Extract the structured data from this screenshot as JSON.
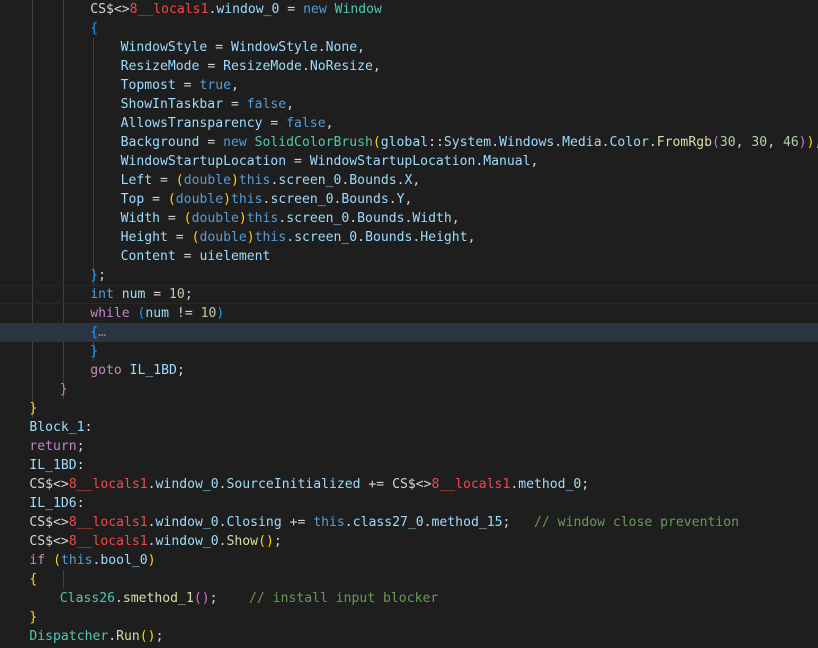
{
  "colors": {
    "background": "#1e1e1e",
    "keyword": "#569cd6",
    "control": "#c586c0",
    "type": "#4ec9b0",
    "property": "#9cdcfe",
    "number": "#b5cea8",
    "function": "#dcdcaa",
    "comment": "#6a9955",
    "bracket_gold": "#ffd700",
    "bracket_orchid": "#da70d6",
    "bracket_blue": "#179fff"
  },
  "code": {
    "lines": [
      {
        "indent": 12,
        "tokens": [
          [
            "txt",
            "CS$<>"
          ],
          [
            "red",
            "8"
          ],
          [
            "red",
            "__locals1"
          ],
          [
            "txt",
            "."
          ],
          [
            "prop",
            "window_0"
          ],
          [
            "txt",
            " = "
          ],
          [
            "kw",
            "new"
          ],
          [
            "txt",
            " "
          ],
          [
            "type",
            "Window"
          ]
        ]
      },
      {
        "indent": 12,
        "tokens": [
          [
            "p3",
            "{"
          ]
        ]
      },
      {
        "indent": 16,
        "tokens": [
          [
            "prop",
            "WindowStyle"
          ],
          [
            "txt",
            " = "
          ],
          [
            "prop",
            "WindowStyle"
          ],
          [
            "txt",
            "."
          ],
          [
            "prop",
            "None"
          ],
          [
            "txt",
            ","
          ]
        ]
      },
      {
        "indent": 16,
        "tokens": [
          [
            "prop",
            "ResizeMode"
          ],
          [
            "txt",
            " = "
          ],
          [
            "prop",
            "ResizeMode"
          ],
          [
            "txt",
            "."
          ],
          [
            "prop",
            "NoResize"
          ],
          [
            "txt",
            ","
          ]
        ]
      },
      {
        "indent": 16,
        "tokens": [
          [
            "prop",
            "Topmost"
          ],
          [
            "txt",
            " = "
          ],
          [
            "kw",
            "true"
          ],
          [
            "txt",
            ","
          ]
        ]
      },
      {
        "indent": 16,
        "tokens": [
          [
            "prop",
            "ShowInTaskbar"
          ],
          [
            "txt",
            " = "
          ],
          [
            "kw",
            "false"
          ],
          [
            "txt",
            ","
          ]
        ]
      },
      {
        "indent": 16,
        "tokens": [
          [
            "prop",
            "AllowsTransparency"
          ],
          [
            "txt",
            " = "
          ],
          [
            "kw",
            "false"
          ],
          [
            "txt",
            ","
          ]
        ]
      },
      {
        "indent": 16,
        "tokens": [
          [
            "prop",
            "Background"
          ],
          [
            "txt",
            " = "
          ],
          [
            "kw",
            "new"
          ],
          [
            "txt",
            " "
          ],
          [
            "type",
            "SolidColorBrush"
          ],
          [
            "p1",
            "("
          ],
          [
            "prop",
            "global"
          ],
          [
            "txt",
            "::"
          ],
          [
            "prop",
            "System"
          ],
          [
            "txt",
            "."
          ],
          [
            "prop",
            "Windows"
          ],
          [
            "txt",
            "."
          ],
          [
            "prop",
            "Media"
          ],
          [
            "txt",
            "."
          ],
          [
            "prop",
            "Color"
          ],
          [
            "txt",
            "."
          ],
          [
            "fn",
            "FromRgb"
          ],
          [
            "p2",
            "("
          ],
          [
            "num",
            "30"
          ],
          [
            "txt",
            ", "
          ],
          [
            "num",
            "30"
          ],
          [
            "txt",
            ", "
          ],
          [
            "num",
            "46"
          ],
          [
            "p2",
            ")"
          ],
          [
            "p1",
            ")"
          ],
          [
            "txt",
            ","
          ]
        ]
      },
      {
        "indent": 16,
        "tokens": [
          [
            "prop",
            "WindowStartupLocation"
          ],
          [
            "txt",
            " = "
          ],
          [
            "prop",
            "WindowStartupLocation"
          ],
          [
            "txt",
            "."
          ],
          [
            "prop",
            "Manual"
          ],
          [
            "txt",
            ","
          ]
        ]
      },
      {
        "indent": 16,
        "tokens": [
          [
            "prop",
            "Left"
          ],
          [
            "txt",
            " = "
          ],
          [
            "p1",
            "("
          ],
          [
            "kw",
            "double"
          ],
          [
            "p1",
            ")"
          ],
          [
            "kw",
            "this"
          ],
          [
            "txt",
            "."
          ],
          [
            "prop",
            "screen_0"
          ],
          [
            "txt",
            "."
          ],
          [
            "prop",
            "Bounds"
          ],
          [
            "txt",
            "."
          ],
          [
            "prop",
            "X"
          ],
          [
            "txt",
            ","
          ]
        ]
      },
      {
        "indent": 16,
        "tokens": [
          [
            "prop",
            "Top"
          ],
          [
            "txt",
            " = "
          ],
          [
            "p1",
            "("
          ],
          [
            "kw",
            "double"
          ],
          [
            "p1",
            ")"
          ],
          [
            "kw",
            "this"
          ],
          [
            "txt",
            "."
          ],
          [
            "prop",
            "screen_0"
          ],
          [
            "txt",
            "."
          ],
          [
            "prop",
            "Bounds"
          ],
          [
            "txt",
            "."
          ],
          [
            "prop",
            "Y"
          ],
          [
            "txt",
            ","
          ]
        ]
      },
      {
        "indent": 16,
        "tokens": [
          [
            "prop",
            "Width"
          ],
          [
            "txt",
            " = "
          ],
          [
            "p1",
            "("
          ],
          [
            "kw",
            "double"
          ],
          [
            "p1",
            ")"
          ],
          [
            "kw",
            "this"
          ],
          [
            "txt",
            "."
          ],
          [
            "prop",
            "screen_0"
          ],
          [
            "txt",
            "."
          ],
          [
            "prop",
            "Bounds"
          ],
          [
            "txt",
            "."
          ],
          [
            "prop",
            "Width"
          ],
          [
            "txt",
            ","
          ]
        ]
      },
      {
        "indent": 16,
        "tokens": [
          [
            "prop",
            "Height"
          ],
          [
            "txt",
            " = "
          ],
          [
            "p1",
            "("
          ],
          [
            "kw",
            "double"
          ],
          [
            "p1",
            ")"
          ],
          [
            "kw",
            "this"
          ],
          [
            "txt",
            "."
          ],
          [
            "prop",
            "screen_0"
          ],
          [
            "txt",
            "."
          ],
          [
            "prop",
            "Bounds"
          ],
          [
            "txt",
            "."
          ],
          [
            "prop",
            "Height"
          ],
          [
            "txt",
            ","
          ]
        ]
      },
      {
        "indent": 16,
        "tokens": [
          [
            "prop",
            "Content"
          ],
          [
            "txt",
            " = "
          ],
          [
            "prop",
            "uielement"
          ]
        ]
      },
      {
        "indent": 12,
        "tokens": [
          [
            "p3",
            "}"
          ],
          [
            "txt",
            ";"
          ]
        ]
      },
      {
        "indent": 12,
        "current": true,
        "tokens": [
          [
            "kw",
            "int"
          ],
          [
            "txt",
            " "
          ],
          [
            "prop",
            "num"
          ],
          [
            "txt",
            " = "
          ],
          [
            "num",
            "10"
          ],
          [
            "txt",
            ";"
          ]
        ]
      },
      {
        "indent": 12,
        "tokens": [
          [
            "ctl",
            "while"
          ],
          [
            "txt",
            " "
          ],
          [
            "p3",
            "("
          ],
          [
            "prop",
            "num"
          ],
          [
            "txt",
            " != "
          ],
          [
            "num",
            "10"
          ],
          [
            "p3",
            ")"
          ]
        ]
      },
      {
        "indent": 12,
        "highlight": true,
        "tokens": [
          [
            "p3",
            "{"
          ],
          [
            "fold",
            "…"
          ]
        ]
      },
      {
        "indent": 12,
        "tokens": [
          [
            "p3",
            "}"
          ]
        ]
      },
      {
        "indent": 12,
        "tokens": [
          [
            "ctl",
            "goto"
          ],
          [
            "txt",
            " "
          ],
          [
            "prop",
            "IL_1BD"
          ],
          [
            "txt",
            ";"
          ]
        ]
      },
      {
        "indent": 8,
        "tokens": [
          [
            "p2",
            "}"
          ]
        ]
      },
      {
        "indent": 4,
        "tokens": [
          [
            "p1",
            "}"
          ]
        ]
      },
      {
        "indent": 4,
        "tokens": [
          [
            "prop",
            "Block_1"
          ],
          [
            "txt",
            ":"
          ]
        ]
      },
      {
        "indent": 4,
        "tokens": [
          [
            "ctl",
            "return"
          ],
          [
            "txt",
            ";"
          ]
        ]
      },
      {
        "indent": 4,
        "tokens": [
          [
            "prop",
            "IL_1BD"
          ],
          [
            "txt",
            ":"
          ]
        ]
      },
      {
        "indent": 4,
        "tokens": [
          [
            "txt",
            "CS$<>"
          ],
          [
            "red",
            "8"
          ],
          [
            "red",
            "__locals1"
          ],
          [
            "txt",
            "."
          ],
          [
            "prop",
            "window_0"
          ],
          [
            "txt",
            "."
          ],
          [
            "prop",
            "SourceInitialized"
          ],
          [
            "txt",
            " += CS$<>"
          ],
          [
            "red",
            "8"
          ],
          [
            "red",
            "__locals1"
          ],
          [
            "txt",
            "."
          ],
          [
            "prop",
            "method_0"
          ],
          [
            "txt",
            ";"
          ]
        ]
      },
      {
        "indent": 4,
        "tokens": [
          [
            "prop",
            "IL_1D6"
          ],
          [
            "txt",
            ":"
          ]
        ]
      },
      {
        "indent": 4,
        "tokens": [
          [
            "txt",
            "CS$<>"
          ],
          [
            "red",
            "8"
          ],
          [
            "red",
            "__locals1"
          ],
          [
            "txt",
            "."
          ],
          [
            "prop",
            "window_0"
          ],
          [
            "txt",
            "."
          ],
          [
            "prop",
            "Closing"
          ],
          [
            "txt",
            " += "
          ],
          [
            "kw",
            "this"
          ],
          [
            "txt",
            "."
          ],
          [
            "prop",
            "class27_0"
          ],
          [
            "txt",
            "."
          ],
          [
            "prop",
            "method_15"
          ],
          [
            "txt",
            ";   "
          ],
          [
            "cmt",
            "// window close prevention"
          ]
        ]
      },
      {
        "indent": 4,
        "tokens": [
          [
            "txt",
            "CS$<>"
          ],
          [
            "red",
            "8"
          ],
          [
            "red",
            "__locals1"
          ],
          [
            "txt",
            "."
          ],
          [
            "prop",
            "window_0"
          ],
          [
            "txt",
            "."
          ],
          [
            "fn",
            "Show"
          ],
          [
            "p1",
            "()"
          ],
          [
            "txt",
            ";"
          ]
        ]
      },
      {
        "indent": 4,
        "tokens": [
          [
            "ctl",
            "if"
          ],
          [
            "txt",
            " "
          ],
          [
            "p1",
            "("
          ],
          [
            "kw",
            "this"
          ],
          [
            "txt",
            "."
          ],
          [
            "prop",
            "bool_0"
          ],
          [
            "p1",
            ")"
          ]
        ]
      },
      {
        "indent": 4,
        "tokens": [
          [
            "p1",
            "{"
          ]
        ]
      },
      {
        "indent": 8,
        "tokens": [
          [
            "type",
            "Class26"
          ],
          [
            "txt",
            "."
          ],
          [
            "fn",
            "smethod_1"
          ],
          [
            "p2",
            "()"
          ],
          [
            "txt",
            ";    "
          ],
          [
            "cmt",
            "// install input blocker"
          ]
        ]
      },
      {
        "indent": 4,
        "tokens": [
          [
            "p1",
            "}"
          ]
        ]
      },
      {
        "indent": 4,
        "tokens": [
          [
            "type",
            "Dispatcher"
          ],
          [
            "txt",
            "."
          ],
          [
            "fn",
            "Run"
          ],
          [
            "p1",
            "()"
          ],
          [
            "txt",
            ";"
          ]
        ]
      }
    ]
  }
}
